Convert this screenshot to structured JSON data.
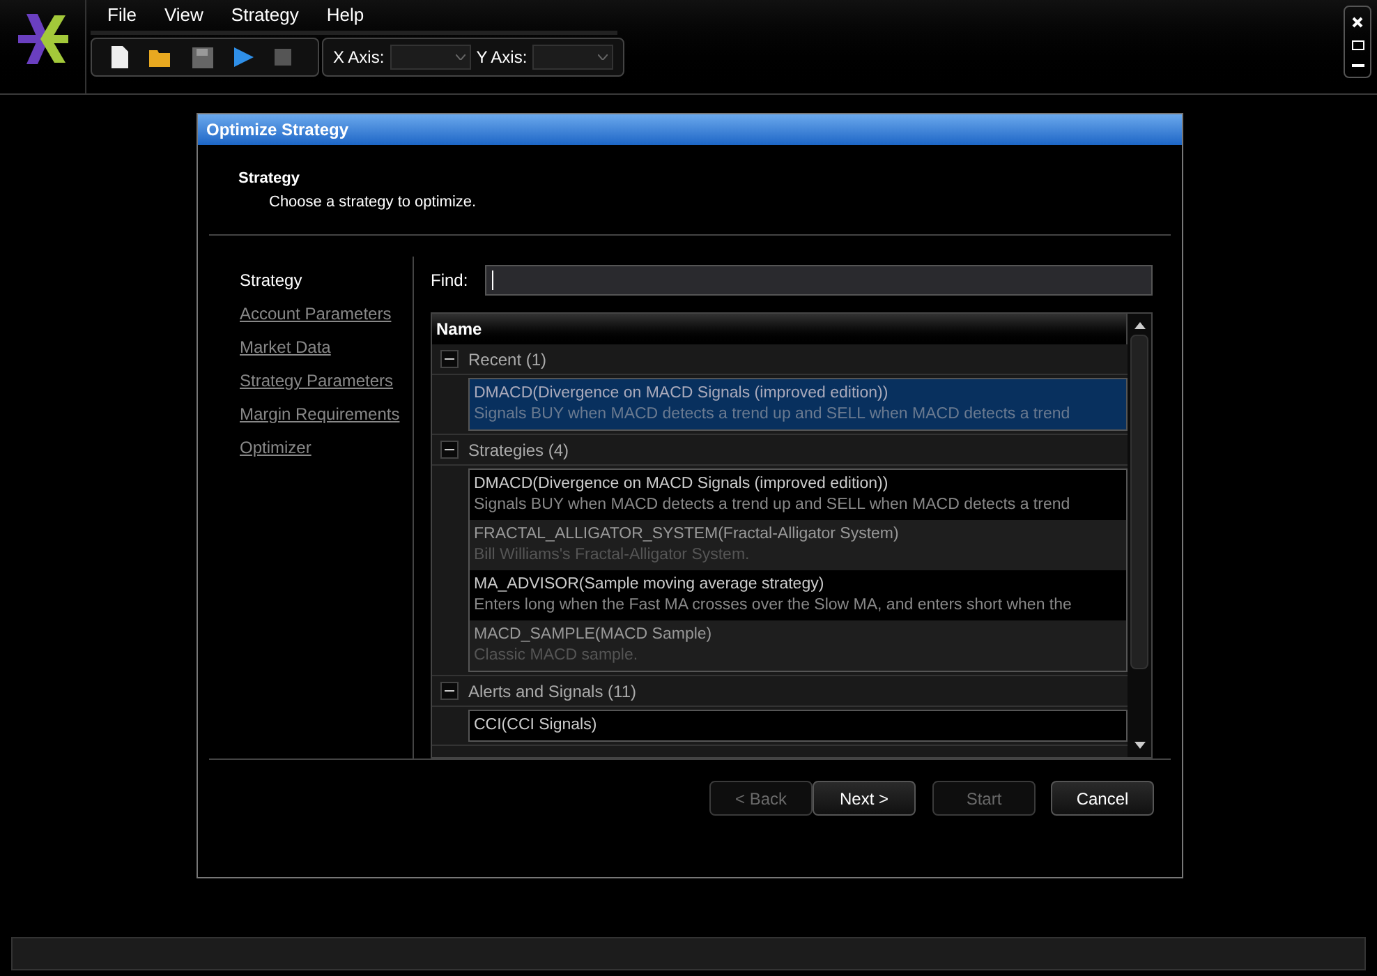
{
  "menu": [
    "File",
    "View",
    "Strategy",
    "Help"
  ],
  "toolbar": {
    "x_axis_label": "X Axis:",
    "y_axis_label": "Y Axis:"
  },
  "dialog": {
    "title": "Optimize Strategy",
    "heading": "Strategy",
    "subheading": "Choose a strategy to optimize.",
    "steps": [
      {
        "label": "Strategy",
        "selected": true
      },
      {
        "label": "Account Parameters",
        "selected": false
      },
      {
        "label": "Market Data",
        "selected": false
      },
      {
        "label": "Strategy Parameters",
        "selected": false
      },
      {
        "label": "Margin Requirements",
        "selected": false
      },
      {
        "label": "Optimizer",
        "selected": false
      }
    ],
    "find_label": "Find:",
    "list": {
      "column": "Name",
      "groups": [
        {
          "label": "Recent (1)",
          "expanded": true,
          "items": [
            {
              "title": "DMACD(Divergence on MACD Signals (improved edition))",
              "description": "Signals BUY when MACD detects a trend up and SELL when MACD detects a trend",
              "selected": true
            }
          ]
        },
        {
          "label": "Strategies (4)",
          "expanded": true,
          "items": [
            {
              "title": "DMACD(Divergence on MACD Signals (improved edition))",
              "description": "Signals BUY when MACD detects a trend up and SELL when MACD detects a trend",
              "selected": false
            },
            {
              "title": "FRACTAL_ALLIGATOR_SYSTEM(Fractal-Alligator System)",
              "description": "Bill Williams's Fractal-Alligator System.",
              "selected": false
            },
            {
              "title": "MA_ADVISOR(Sample moving average strategy)",
              "description": "Enters long when the Fast MA crosses over the Slow MA, and enters short when the",
              "selected": false
            },
            {
              "title": "MACD_SAMPLE(MACD Sample)",
              "description": "Classic MACD sample.",
              "selected": false
            }
          ]
        },
        {
          "label": "Alerts and Signals (11)",
          "expanded": true,
          "items": [
            {
              "title": "CCI(CCI Signals)",
              "selected": false
            }
          ]
        }
      ]
    },
    "buttons": [
      {
        "label": "< Back",
        "disabled": true
      },
      {
        "label": "Next >",
        "disabled": false
      },
      {
        "label": "Start",
        "disabled": true
      },
      {
        "label": "Cancel",
        "disabled": false
      }
    ]
  }
}
